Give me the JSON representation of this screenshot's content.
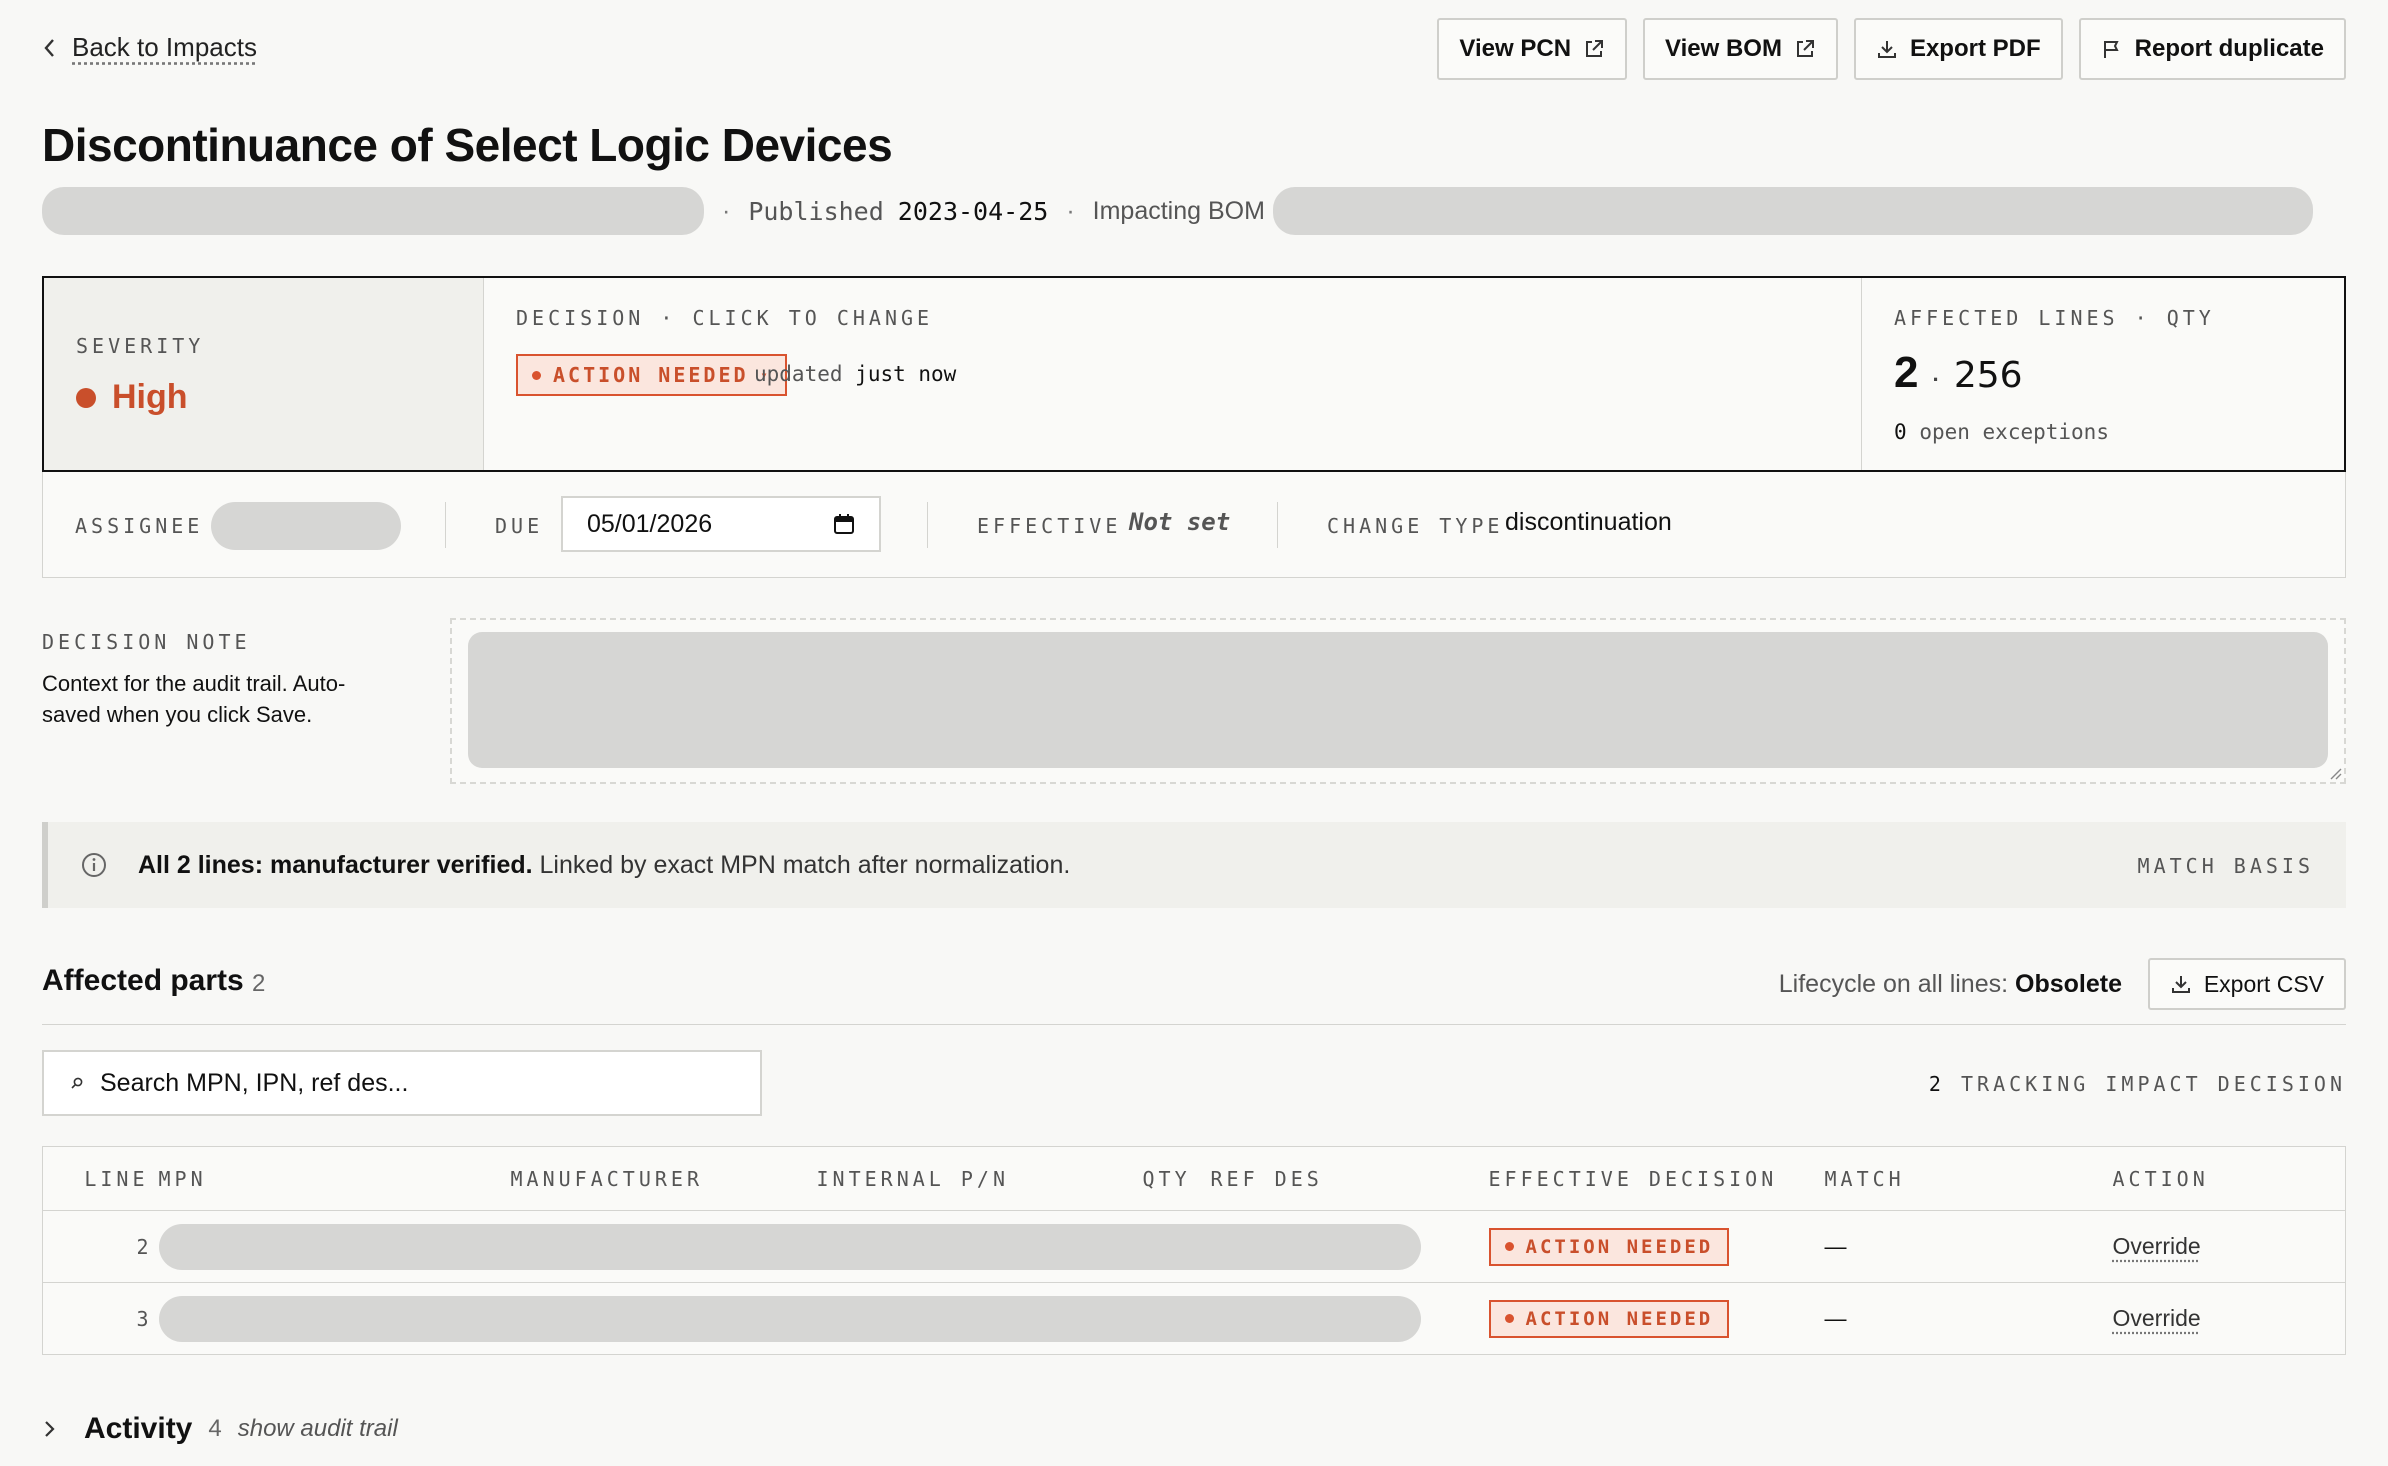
{
  "nav": {
    "back_label": "Back to Impacts"
  },
  "toolbar": {
    "view_pcn": "View PCN",
    "view_bom": "View BOM",
    "export_pdf": "Export PDF",
    "report_duplicate": "Report duplicate"
  },
  "header": {
    "title": "Discontinuance of Select Logic Devices",
    "published_label": "Published",
    "published_date": "2023-04-25",
    "impacting_label": "Impacting BOM"
  },
  "panel": {
    "severity_label": "SEVERITY",
    "severity_value": "High",
    "decision_label": "DECISION · CLICK TO CHANGE",
    "decision_value": "ACTION NEEDED",
    "updated_prefix": "updated",
    "updated_value": "just now",
    "affected_label": "AFFECTED LINES · QTY",
    "affected_lines": "2",
    "affected_sep": "·",
    "affected_qty": "256",
    "exceptions_count": "0",
    "exceptions_suffix": "open exceptions"
  },
  "fields": {
    "assignee_label": "ASSIGNEE",
    "due_label": "DUE",
    "due_value": "05/01/2026",
    "effective_label": "EFFECTIVE",
    "effective_value": "Not set",
    "change_type_label": "CHANGE TYPE",
    "change_type_value": "discontinuation"
  },
  "note": {
    "label": "DECISION NOTE",
    "help": "Context for the audit trail. Auto-saved when you click Save."
  },
  "banner": {
    "bold": "All 2 lines: manufacturer verified.",
    "text": " Linked by exact MPN match after normalization.",
    "basis": "MATCH BASIS"
  },
  "parts": {
    "title": "Affected parts",
    "count": "2",
    "lifecycle_label": "Lifecycle on all lines:",
    "lifecycle_value": "Obsolete",
    "export_csv": "Export CSV",
    "search_placeholder": "Search MPN, IPN, ref des...",
    "tracking_count": "2",
    "tracking_label": "TRACKING IMPACT DECISION",
    "columns": [
      "LINE",
      "MPN",
      "MANUFACTURER",
      "INTERNAL P/N",
      "QTY",
      "REF DES",
      "EFFECTIVE DECISION",
      "MATCH",
      "ACTION"
    ],
    "rows": [
      {
        "line": "2",
        "decision": "ACTION NEEDED",
        "match": "—",
        "action": "Override"
      },
      {
        "line": "3",
        "decision": "ACTION NEEDED",
        "match": "—",
        "action": "Override"
      }
    ]
  },
  "activity": {
    "title": "Activity",
    "count": "4",
    "hint": "show audit trail"
  },
  "colors": {
    "accent": "#c94f2b",
    "badge_bg": "#fbe6de",
    "background": "#f8f8f6",
    "redacted": "#d6d6d4"
  },
  "icons": [
    "chevron-left-icon",
    "external-link-icon",
    "download-icon",
    "flag-icon",
    "calendar-icon",
    "info-icon",
    "search-icon",
    "chevron-right-icon"
  ]
}
